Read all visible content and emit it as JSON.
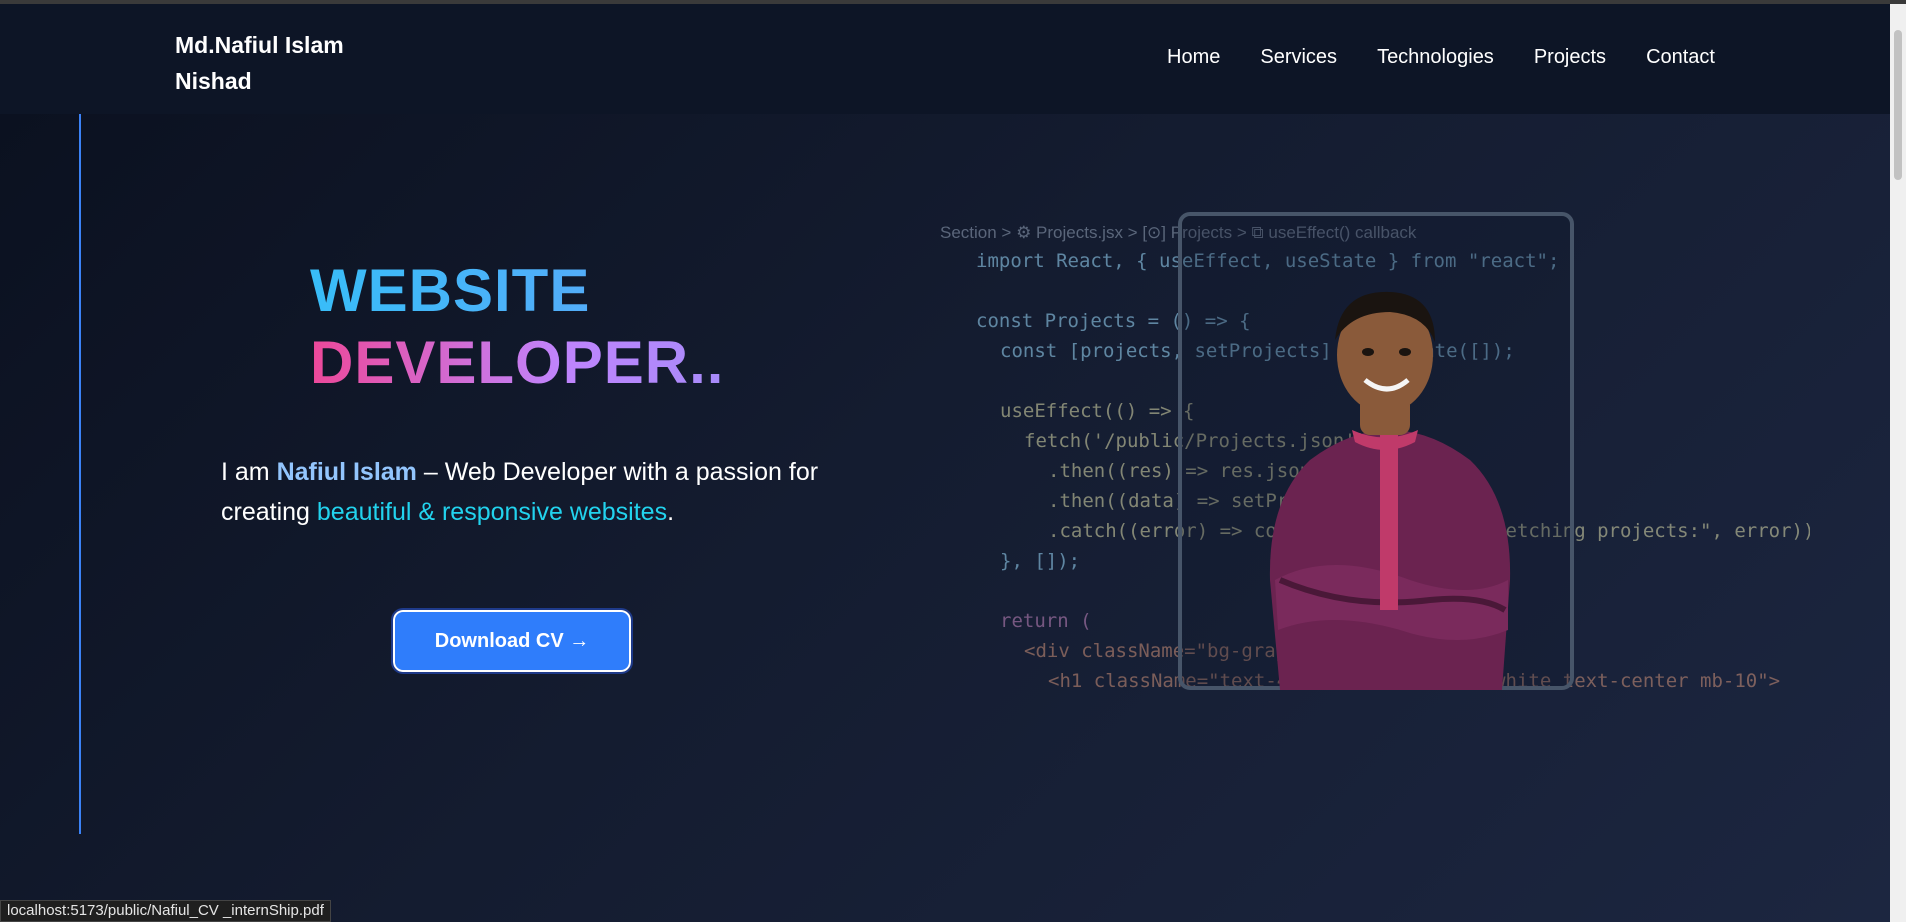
{
  "nav": {
    "brand": "Md.Nafiul Islam Nishad",
    "links": [
      "Home",
      "Services",
      "Technologies",
      "Projects",
      "Contact"
    ]
  },
  "hero": {
    "headline_line1": "WEBSITE",
    "headline_line2": "DEVELOPER..",
    "intro_prefix": "I am ",
    "intro_name": "Nafiul Islam",
    "intro_middle": " – Web Developer with a passion for creating ",
    "intro_accent": "beautiful & responsive websites",
    "intro_suffix": ".",
    "cv_button": "Download CV →"
  },
  "code": {
    "breadcrumb": "Section > ⚙ Projects.jsx > [⊙] Projects > ⧉ useEffect() callback",
    "lines": [
      "import React, { useEffect, useState } from \"react\";",
      "const Projects = () => {",
      "const [projects, setProjects] = useState([]);",
      "useEffect(() => {",
      "fetch('/public/Projects.json')",
      ".then((res) => res.json())",
      ".then((data) => setProjects(data))",
      ".catch((error) => console.error(\"Error fetching projects:\", error));",
      "}, []);",
      "return (",
      "<div className=\"bg-gray-900 px-5\">",
      "<h1 className=\"text-4xl font-bold text-white text-center mb-10\">"
    ]
  },
  "status_bar": {
    "url": "localhost:5173/public/Nafiul_CV _internShip.pdf"
  },
  "colors": {
    "accent_blue": "#2f7dfb",
    "headline_cyan": "#38bdf8",
    "headline_pink": "#ec4899",
    "highlight_cyan": "#22d3ee",
    "background": "#0b1120"
  }
}
